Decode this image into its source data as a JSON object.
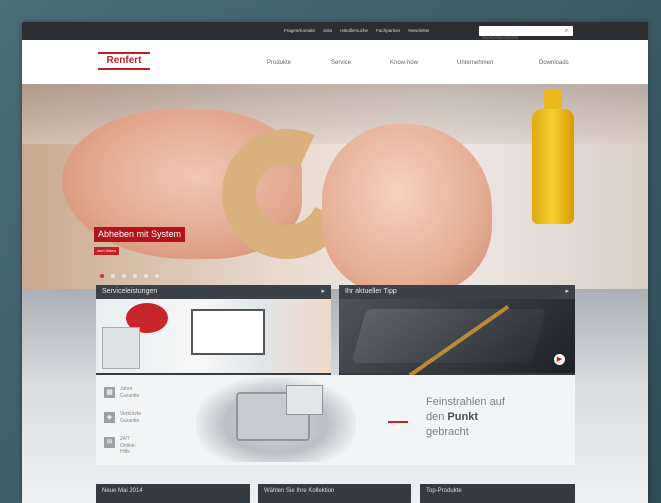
{
  "topbar": {
    "links": [
      "Fragen/Kontakt",
      "Jobs",
      "Händlersuche",
      "Fachpartner",
      "Newsletter"
    ],
    "search_placeholder": "Suche/Stichwörter"
  },
  "logo": {
    "text": "Renfert"
  },
  "nav": {
    "items": [
      "Produkte",
      "Service",
      "Know-how",
      "Unternehmen",
      "Downloads"
    ]
  },
  "hero": {
    "caption": "Abheben mit System",
    "more_label": "zum Video",
    "slide_count": 6,
    "active_slide": 1
  },
  "panels": {
    "service": {
      "title": "Serviceleistungen",
      "arrow": "▸"
    },
    "tip": {
      "title": "Ihr aktueller Tipp",
      "arrow": "▸"
    }
  },
  "banner": {
    "features": [
      {
        "icon": "calendar-icon",
        "line1": "Jahre",
        "line2": "Garantie"
      },
      {
        "icon": "shield-icon",
        "line1": "Verkürzte",
        "line2": "Garantie"
      },
      {
        "icon": "chat-icon",
        "line1": "24/7",
        "line2": "Online-Hilfe"
      }
    ],
    "slogan_line1": "Feinstrahlen auf",
    "slogan_prefix": "den ",
    "slogan_bold": "Punkt",
    "slogan_line3": "gebracht"
  },
  "bottom_strips": [
    "Neue Mai 2014",
    "Wählen Sie Ihre Kollektion",
    "Top-Produkte"
  ],
  "colors": {
    "brand_red": "#c41f24",
    "topbar": "#2b2f33",
    "panel": "#333a40"
  }
}
